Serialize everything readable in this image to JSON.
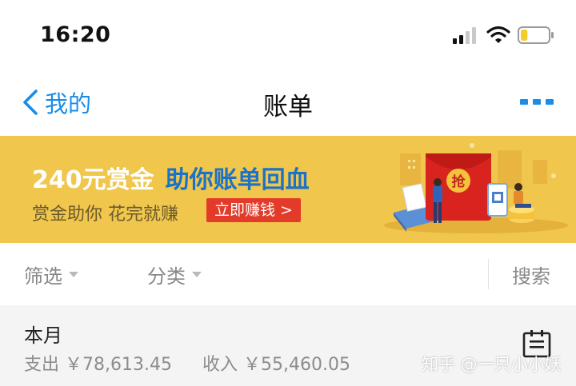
{
  "status_bar": {
    "time": "16:20",
    "signal_icon": "cellular-signal-icon",
    "wifi_icon": "wifi-icon",
    "battery_icon": "battery-icon",
    "battery_level": 0.25,
    "battery_color": "#f2cd2e"
  },
  "nav": {
    "back_label": "我的",
    "title": "账单",
    "back_icon": "chevron-left-icon",
    "more_icon": "more-icon",
    "accent_color": "#1a8de8"
  },
  "banner": {
    "title_white": "240元赏金",
    "title_blue": "助你账单回血",
    "subtitle": "赏金助你 花完就赚",
    "cta_label": "立即赚钱 >",
    "background_color": "#f0c64d",
    "illustration_badge": "抢"
  },
  "filters": {
    "filter_label": "筛选",
    "category_label": "分类",
    "search_label": "搜索"
  },
  "month": {
    "title": "本月",
    "expense_label": "支出",
    "expense_value": "￥78,613.45",
    "income_label": "收入",
    "income_value": "￥55,460.05",
    "calendar_icon": "calendar-icon"
  },
  "watermark": "知乎 @一只小小妖"
}
